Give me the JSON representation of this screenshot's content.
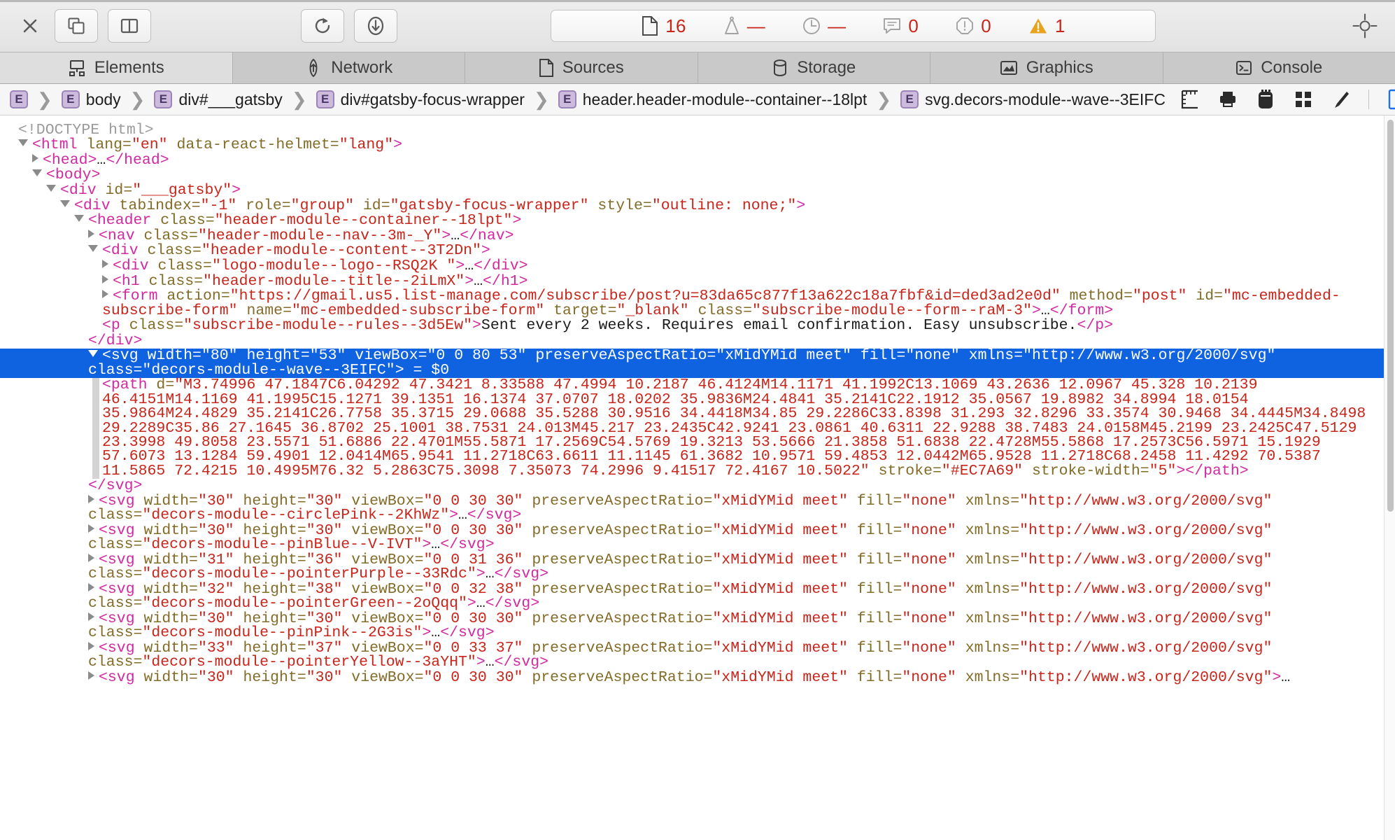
{
  "app": {
    "name": "Safari Web Inspector"
  },
  "toolbar": {
    "close_label": "✕",
    "buttons": [
      {
        "name": "dock-to-window",
        "label": ""
      },
      {
        "name": "dock-side-by-side",
        "label": ""
      },
      {
        "name": "reload-page",
        "label": ""
      },
      {
        "name": "download-web-archive",
        "label": ""
      }
    ],
    "status": [
      {
        "icon": "resource-document-icon",
        "value": "16",
        "state": "active"
      },
      {
        "icon": "weight-transfer-size-icon",
        "value": "—",
        "state": "dim"
      },
      {
        "icon": "clock-load-time-icon",
        "value": "—",
        "state": "dim"
      },
      {
        "icon": "console-log-icon",
        "value": "0",
        "state": "dim"
      },
      {
        "icon": "error-octagon-icon",
        "value": "0",
        "state": "dim"
      },
      {
        "icon": "warning-triangle-icon",
        "value": "1",
        "state": "warn"
      }
    ],
    "inspect_element_label": "",
    "warning_color": "#E8A21C"
  },
  "tabs": [
    {
      "id": "elements",
      "label": "Elements",
      "icon": "elements-icon",
      "selected": true
    },
    {
      "id": "network",
      "label": "Network",
      "icon": "network-icon",
      "selected": false
    },
    {
      "id": "sources",
      "label": "Sources",
      "icon": "sources-icon",
      "selected": false
    },
    {
      "id": "storage",
      "label": "Storage",
      "icon": "storage-icon",
      "selected": false
    },
    {
      "id": "graphics",
      "label": "Graphics",
      "icon": "graphics-icon",
      "selected": false
    },
    {
      "id": "console",
      "label": "Console",
      "icon": "console-icon",
      "selected": false
    }
  ],
  "breadcrumb": {
    "badge_letter": "E",
    "separator": "❯",
    "items": [
      {
        "label": ""
      },
      {
        "label": "body"
      },
      {
        "label": "div#___gatsby"
      },
      {
        "label": "div#gatsby-focus-wrapper"
      },
      {
        "label": "header.header-module--container--18lpt"
      },
      {
        "label": "svg.decors-module--wave--3EIFC"
      }
    ],
    "tools": [
      {
        "name": "layout-rulers-icon"
      },
      {
        "name": "print-styles-icon"
      },
      {
        "name": "force-appearance-icon"
      },
      {
        "name": "grid-overlay-icon"
      },
      {
        "name": "paint-brush-icon"
      },
      {
        "name": "show-details-sidebar-icon"
      }
    ]
  },
  "dom": {
    "doctype": "<!DOCTYPE html>",
    "lines": [
      {
        "indent": 0,
        "tw": "none",
        "type": "doctype",
        "text": "<!DOCTYPE html>"
      },
      {
        "indent": 0,
        "tw": "open",
        "tag": "html",
        "attrs": [
          [
            "lang",
            "en"
          ],
          [
            "data-react-helmet",
            "lang"
          ]
        ],
        "close": ">"
      },
      {
        "indent": 1,
        "tw": "closed",
        "tag": "head",
        "attrs": [],
        "collapsed": true
      },
      {
        "indent": 1,
        "tw": "open",
        "tag": "body",
        "attrs": [],
        "close": ">"
      },
      {
        "indent": 2,
        "tw": "open",
        "tag": "div",
        "attrs": [
          [
            "id",
            "___gatsby"
          ]
        ],
        "close": ">"
      },
      {
        "indent": 3,
        "tw": "open",
        "tag": "div",
        "attrs": [
          [
            "tabindex",
            "-1"
          ],
          [
            "role",
            "group"
          ],
          [
            "id",
            "gatsby-focus-wrapper"
          ],
          [
            "style",
            "outline: none;"
          ]
        ],
        "close": ">"
      },
      {
        "indent": 4,
        "tw": "open",
        "tag": "header",
        "attrs": [
          [
            "class",
            "header-module--container--18lpt"
          ]
        ],
        "close": ">"
      },
      {
        "indent": 5,
        "tw": "closed",
        "tag": "nav",
        "attrs": [
          [
            "class",
            "header-module--nav--3m-_Y"
          ]
        ],
        "collapsed": true
      },
      {
        "indent": 5,
        "tw": "open",
        "tag": "div",
        "attrs": [
          [
            "class",
            "header-module--content--3T2Dn"
          ]
        ],
        "close": ">"
      },
      {
        "indent": 6,
        "tw": "closed",
        "tag": "div",
        "attrs": [
          [
            "class",
            "logo-module--logo--RSQ2K "
          ]
        ],
        "collapsed": true
      },
      {
        "indent": 6,
        "tw": "closed",
        "tag": "h1",
        "attrs": [
          [
            "class",
            "header-module--title--2iLmX"
          ]
        ],
        "collapsed": true
      },
      {
        "indent": 6,
        "tw": "closed",
        "tag": "form",
        "attrs": [
          [
            "action",
            "https://gmail.us5.list-manage.com/subscribe/post?u=83da65c877f13a622c18a7fbf&id=ded3ad2e0d"
          ],
          [
            "method",
            "post"
          ],
          [
            "id",
            "mc-embedded-subscribe-form"
          ],
          [
            "name",
            "mc-embedded-subscribe-form"
          ],
          [
            "target",
            "_blank"
          ],
          [
            "class",
            "subscribe-module--form--raM-3"
          ]
        ],
        "collapsed": true
      },
      {
        "indent": 6,
        "tw": "none",
        "tag": "p",
        "attrs": [
          [
            "class",
            "subscribe-module--rules--3d5Ew"
          ]
        ],
        "inline_text": "Sent every 2 weeks. Requires email confirmation. Easy unsubscribe."
      },
      {
        "indent": 5,
        "tw": "none",
        "type": "closetag",
        "tag": "div"
      },
      {
        "indent": 5,
        "tw": "open",
        "selected": true,
        "tag": "svg",
        "attrs": [
          [
            "width",
            "80"
          ],
          [
            "height",
            "53"
          ],
          [
            "viewBox",
            "0 0 80 53"
          ],
          [
            "preserveAspectRatio",
            "xMidYMid meet"
          ],
          [
            "fill",
            "none"
          ],
          [
            "xmlns",
            "http://www.w3.org/2000/svg"
          ],
          [
            "class",
            "decors-module--wave--3EIFC"
          ]
        ],
        "close": ">",
        "suffix": " = $0"
      },
      {
        "indent": 6,
        "tw": "none",
        "tag": "path",
        "attrs": [
          [
            "d",
            "M3.74996 47.1847C6.04292 47.3421 8.33588 47.4994 10.2187 46.4124M14.1171 41.1992C13.1069 43.2636 12.0967 45.328 10.2139 46.4151M14.1169 41.1995C15.1271 39.1351 16.1374 37.0707 18.0202 35.9836M24.4841 35.2141C22.1912 35.0567 19.8982 34.8994 18.0154 35.9864M24.4829 35.2141C26.7758 35.3715 29.0688 35.5288 30.9516 34.4418M34.85 29.2286C33.8398 31.293 32.8296 33.3574 30.9468 34.4445M34.8498 29.2289C35.86 27.1645 36.8702 25.1001 38.7531 24.013M45.217 23.2435C42.9241 23.0861 40.6311 22.9288 38.7483 24.0158M45.2199 23.2425C47.5129 23.3998 49.8058 23.5571 51.6886 22.4701M55.5871 17.2569C54.5769 19.3213 53.5666 21.3858 51.6838 22.4728M55.5868 17.2573C56.5971 15.1929 57.6073 13.1284 59.4901 12.0414M65.9541 11.2718C63.6611 11.1145 61.3682 10.9571 59.4853 12.0442M65.9528 11.2718C68.2458 11.4292 70.5387 11.5865 72.4215 10.4995M76.32 5.2863C75.3098 7.35073 74.2996 9.41517 72.4167 10.5022"
          ],
          [
            "stroke",
            "#EC7A69"
          ],
          [
            "stroke-width",
            "5"
          ]
        ],
        "close": "></path>"
      },
      {
        "indent": 5,
        "tw": "none",
        "type": "closetag",
        "tag": "svg"
      },
      {
        "indent": 5,
        "tw": "closed",
        "tag": "svg",
        "attrs": [
          [
            "width",
            "30"
          ],
          [
            "height",
            "30"
          ],
          [
            "viewBox",
            "0 0 30 30"
          ],
          [
            "preserveAspectRatio",
            "xMidYMid meet"
          ],
          [
            "fill",
            "none"
          ],
          [
            "xmlns",
            "http://www.w3.org/2000/svg"
          ],
          [
            "class",
            "decors-module--circlePink--2KhWz"
          ]
        ],
        "collapsed": true
      },
      {
        "indent": 5,
        "tw": "closed",
        "tag": "svg",
        "attrs": [
          [
            "width",
            "30"
          ],
          [
            "height",
            "30"
          ],
          [
            "viewBox",
            "0 0 30 30"
          ],
          [
            "preserveAspectRatio",
            "xMidYMid meet"
          ],
          [
            "fill",
            "none"
          ],
          [
            "xmlns",
            "http://www.w3.org/2000/svg"
          ],
          [
            "class",
            "decors-module--pinBlue--V-IVT"
          ]
        ],
        "collapsed": true
      },
      {
        "indent": 5,
        "tw": "closed",
        "tag": "svg",
        "attrs": [
          [
            "width",
            "31"
          ],
          [
            "height",
            "36"
          ],
          [
            "viewBox",
            "0 0 31 36"
          ],
          [
            "preserveAspectRatio",
            "xMidYMid meet"
          ],
          [
            "fill",
            "none"
          ],
          [
            "xmlns",
            "http://www.w3.org/2000/svg"
          ],
          [
            "class",
            "decors-module--pointerPurple--33Rdc"
          ]
        ],
        "collapsed": true
      },
      {
        "indent": 5,
        "tw": "closed",
        "tag": "svg",
        "attrs": [
          [
            "width",
            "32"
          ],
          [
            "height",
            "38"
          ],
          [
            "viewBox",
            "0 0 32 38"
          ],
          [
            "preserveAspectRatio",
            "xMidYMid meet"
          ],
          [
            "fill",
            "none"
          ],
          [
            "xmlns",
            "http://www.w3.org/2000/svg"
          ],
          [
            "class",
            "decors-module--pointerGreen--2oQqq"
          ]
        ],
        "collapsed": true
      },
      {
        "indent": 5,
        "tw": "closed",
        "tag": "svg",
        "attrs": [
          [
            "width",
            "30"
          ],
          [
            "height",
            "30"
          ],
          [
            "viewBox",
            "0 0 30 30"
          ],
          [
            "preserveAspectRatio",
            "xMidYMid meet"
          ],
          [
            "fill",
            "none"
          ],
          [
            "xmlns",
            "http://www.w3.org/2000/svg"
          ],
          [
            "class",
            "decors-module--pinPink--2G3is"
          ]
        ],
        "collapsed": true
      },
      {
        "indent": 5,
        "tw": "closed",
        "tag": "svg",
        "attrs": [
          [
            "width",
            "33"
          ],
          [
            "height",
            "37"
          ],
          [
            "viewBox",
            "0 0 33 37"
          ],
          [
            "preserveAspectRatio",
            "xMidYMid meet"
          ],
          [
            "fill",
            "none"
          ],
          [
            "xmlns",
            "http://www.w3.org/2000/svg"
          ],
          [
            "class",
            "decors-module--pointerYellow--3aYHT"
          ]
        ],
        "collapsed": true
      },
      {
        "indent": 5,
        "tw": "closed",
        "tag": "svg",
        "attrs": [
          [
            "width",
            "30"
          ],
          [
            "height",
            "30"
          ],
          [
            "viewBox",
            "0 0 30 30"
          ],
          [
            "preserveAspectRatio",
            "xMidYMid meet"
          ],
          [
            "fill",
            "none"
          ],
          [
            "xmlns",
            "http://www.w3.org/2000/svg"
          ]
        ],
        "collapsed": true,
        "truncated": true
      }
    ],
    "ellipsis": "…",
    "selected_suffix": " = $0",
    "selection_color": "#0F62E0",
    "tag_color": "#D329A0",
    "attr_color": "#836C28",
    "value_color": "#C8251B"
  }
}
